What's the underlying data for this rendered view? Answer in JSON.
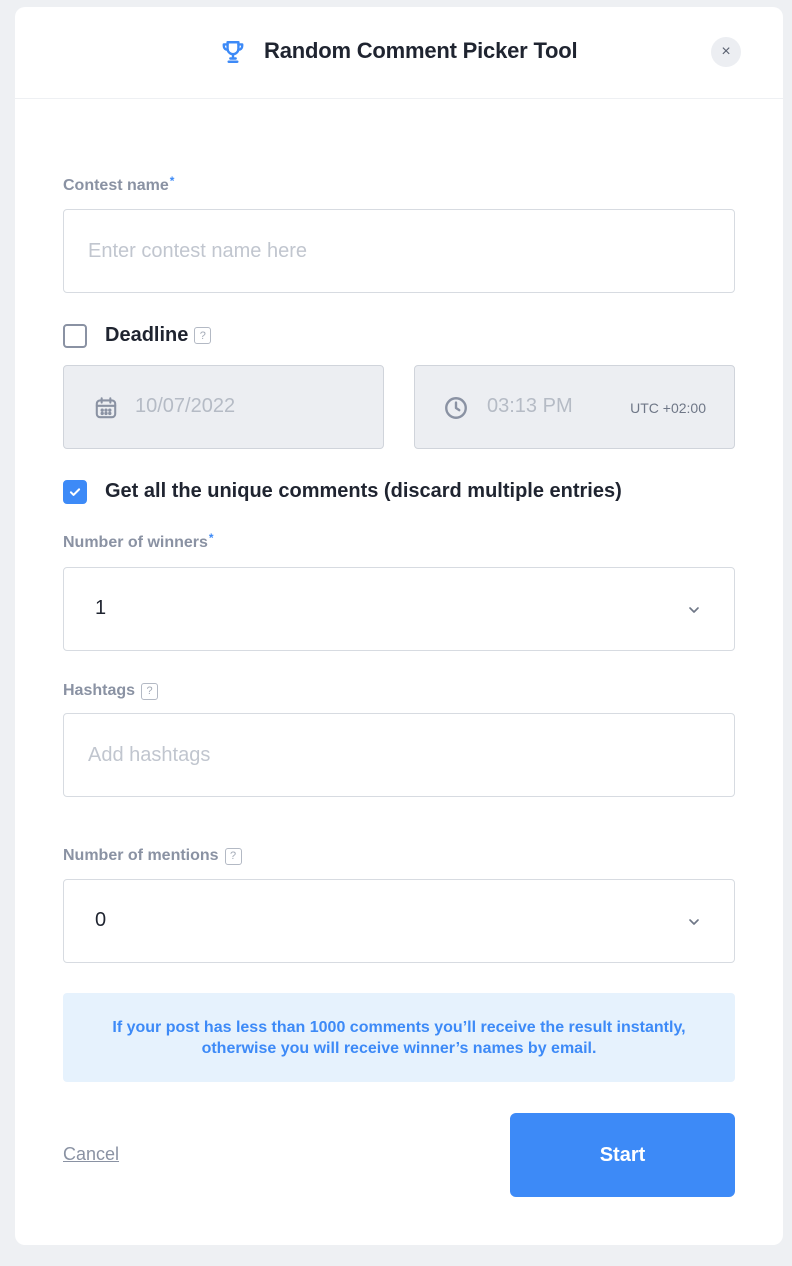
{
  "header": {
    "title": "Random Comment Picker Tool",
    "close_label": "×",
    "icon": "trophy-icon"
  },
  "contest_name": {
    "label": "Contest name",
    "required_mark": "*",
    "placeholder": "Enter contest name here",
    "value": ""
  },
  "deadline": {
    "label": "Deadline",
    "help": "?",
    "checked": false,
    "date": "10/07/2022",
    "time": "03:13 PM",
    "timezone": "UTC +02:00"
  },
  "unique_comments": {
    "label": "Get all the unique comments (discard multiple entries)",
    "checked": true
  },
  "winners": {
    "label": "Number of winners",
    "required_mark": "*",
    "value": "1"
  },
  "hashtags": {
    "label": "Hashtags",
    "help": "?",
    "placeholder": "Add hashtags",
    "value": ""
  },
  "mentions": {
    "label": "Number of mentions",
    "help": "?",
    "value": "0"
  },
  "info_text": "If your post has less than 1000 comments you’ll receive the result instantly, otherwise you will receive winner’s names by email.",
  "actions": {
    "cancel_label": "Cancel",
    "start_label": "Start"
  },
  "colors": {
    "accent": "#3d8af7",
    "info_bg": "#e6f2fd",
    "label": "#8a92a3"
  }
}
